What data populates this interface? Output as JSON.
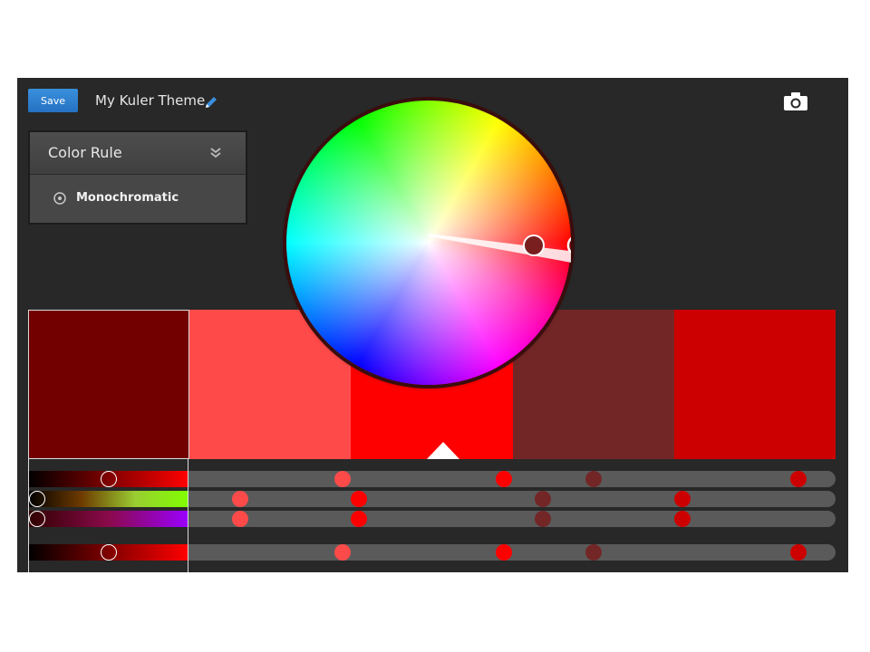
{
  "header": {
    "save_label": "Save",
    "theme_title": "My Kuler Theme",
    "edit_icon": "pencil-icon",
    "camera_icon": "camera-icon"
  },
  "color_rule": {
    "title": "Color Rule",
    "expand_icon": "double-chevron-down-icon",
    "selected_option": "Monochromatic"
  },
  "palette": {
    "selected_index": 0,
    "swatches": [
      "#730000",
      "#ff4a4a",
      "#ff0000",
      "#732626",
      "#cc0000"
    ]
  },
  "colors": {
    "app_bg": "#282828",
    "accent_blue": "#2f80d0",
    "track": "#5a5a5a"
  }
}
